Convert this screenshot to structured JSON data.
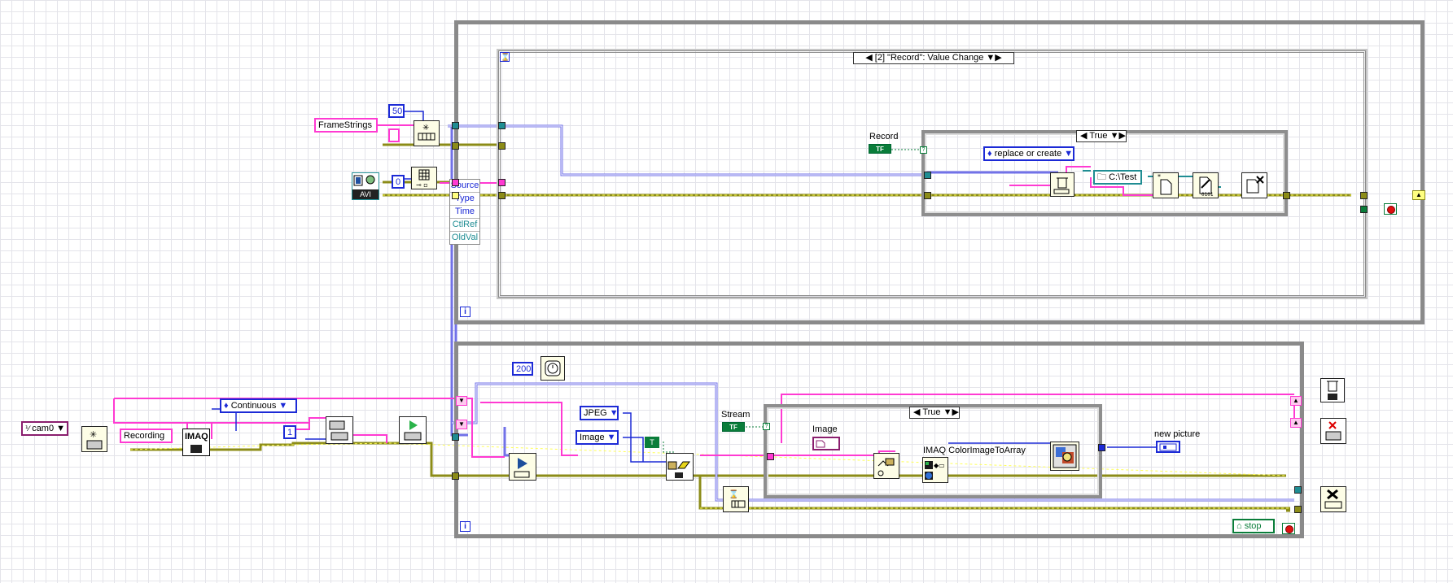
{
  "event_structure": {
    "selector_label": "[2] \"Record\": Value Change",
    "event_data_fields": [
      "Source",
      "Type",
      "Time",
      "CtlRef",
      "OldVal"
    ]
  },
  "constants": {
    "frame_strings": "FrameStrings",
    "queue_size": "50",
    "zero": "0",
    "camera": "cam0",
    "recording": "Recording",
    "mode": "Continuous",
    "one": "1",
    "wait_ms": "200",
    "jpeg": "JPEG",
    "image_type": "Image",
    "open_mode": "replace or create",
    "path": "C:\\Test"
  },
  "labels": {
    "record": "Record",
    "stream": "Stream",
    "image": "Image",
    "color_to_array": "IMAQ ColorImageToArray",
    "new_picture": "new picture",
    "stop": "stop",
    "imaq": "IMAQ",
    "avi": "AVI"
  },
  "case_structures": {
    "upper_case": "True",
    "lower_case": "True"
  },
  "loops": {
    "iteration_terminal": "i"
  },
  "bool_terminal": "TF",
  "colors": {
    "image_wire": "#7272e8",
    "string_wire": "#ff3ad2",
    "error_wire": "#8c8c18",
    "refnum_wire": "#1f8d93",
    "bool_wire": "#0a7d3a",
    "loop_border": "#8a8a8a"
  }
}
